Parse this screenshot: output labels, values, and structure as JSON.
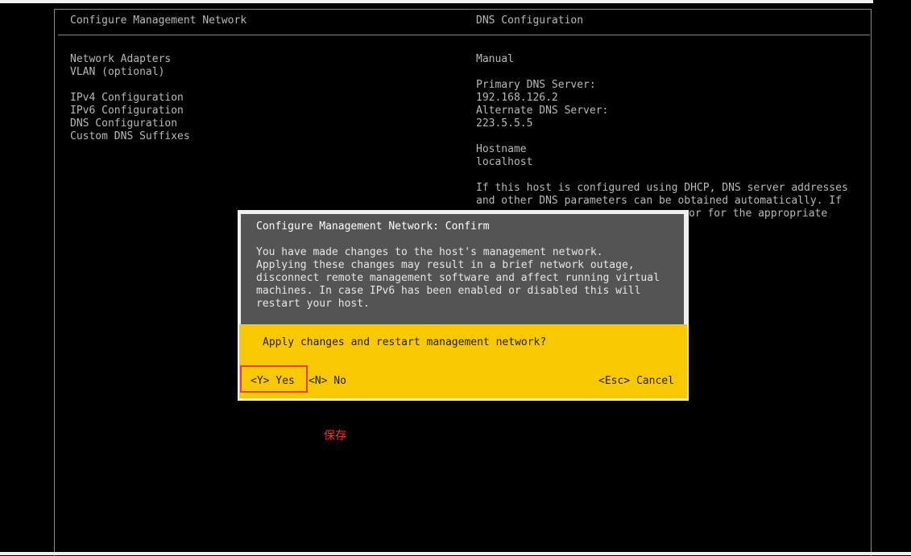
{
  "left_menu": {
    "header": "Configure Management Network",
    "items": [
      "Network Adapters",
      "VLAN (optional)",
      "IPv4 Configuration",
      "IPv6 Configuration",
      "DNS Configuration",
      "Custom DNS Suffixes"
    ]
  },
  "right_panel": {
    "header": "DNS Configuration",
    "mode": "Manual",
    "primary_dns_label": "Primary DNS Server:",
    "primary_dns_value": "192.168.126.2",
    "alternate_dns_label": "Alternate DNS Server:",
    "alternate_dns_value": "223.5.5.5",
    "hostname_label": "Hostname",
    "hostname_value": "localhost",
    "help_lines": [
      "If this host is configured using DHCP, DNS server addresses",
      "and other DNS parameters can be obtained automatically. If",
      "or for the appropriate"
    ]
  },
  "dialog": {
    "title": "Configure Management Network: Confirm",
    "message_lines": [
      "You have made changes to the host's management network.",
      "Applying these changes may result in a brief network outage,",
      "disconnect remote management software and affect running virtual",
      "machines. In case IPv6 has been enabled or disabled this will",
      "restart your host."
    ],
    "question": "Apply changes and restart management network?",
    "yes_label": "<Y> Yes",
    "no_label": "<N> No",
    "cancel_label": "<Esc> Cancel"
  },
  "annotation": {
    "text": "保存",
    "color": "#ff3030"
  },
  "colors": {
    "background": "#000000",
    "text": "#b8b8b8",
    "dialog_gray": "#545454",
    "dialog_yellow": "#f8c800",
    "highlight": "#e8413c"
  }
}
